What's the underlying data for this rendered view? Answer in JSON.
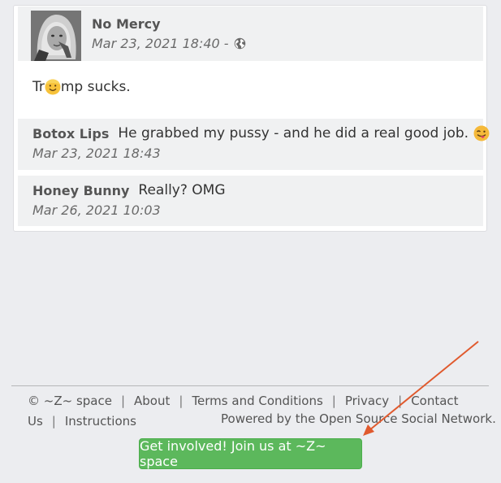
{
  "post": {
    "author": "No Mercy",
    "timestamp": "Mar 23, 2021 18:40 -",
    "privacy_icon": "globe-icon",
    "text_before": "Tr",
    "text_emoji": "grimacing-face-emoji",
    "text_after": "mp sucks."
  },
  "comments": [
    {
      "author": "Botox Lips",
      "text": "He grabbed my pussy - and he did a real good job.",
      "emoji": "winking-tongue-emoji",
      "time": "Mar 23, 2021 18:43"
    },
    {
      "author": "Honey Bunny",
      "text": "Really? OMG",
      "time": "Mar 26, 2021 10:03"
    }
  ],
  "footer": {
    "copyright": "© ~Z~ space",
    "about": "About",
    "terms": "Terms and Conditions",
    "privacy": "Privacy",
    "contact": "Contact",
    "contact_cont": "Us",
    "instructions": "Instructions",
    "powered": "Powered by the Open Source Social Network."
  },
  "cta": {
    "label": "Get involved! Join us at ~Z~ space",
    "color": "#5cb85c"
  },
  "annotation": {
    "color": "#e05a2e"
  }
}
